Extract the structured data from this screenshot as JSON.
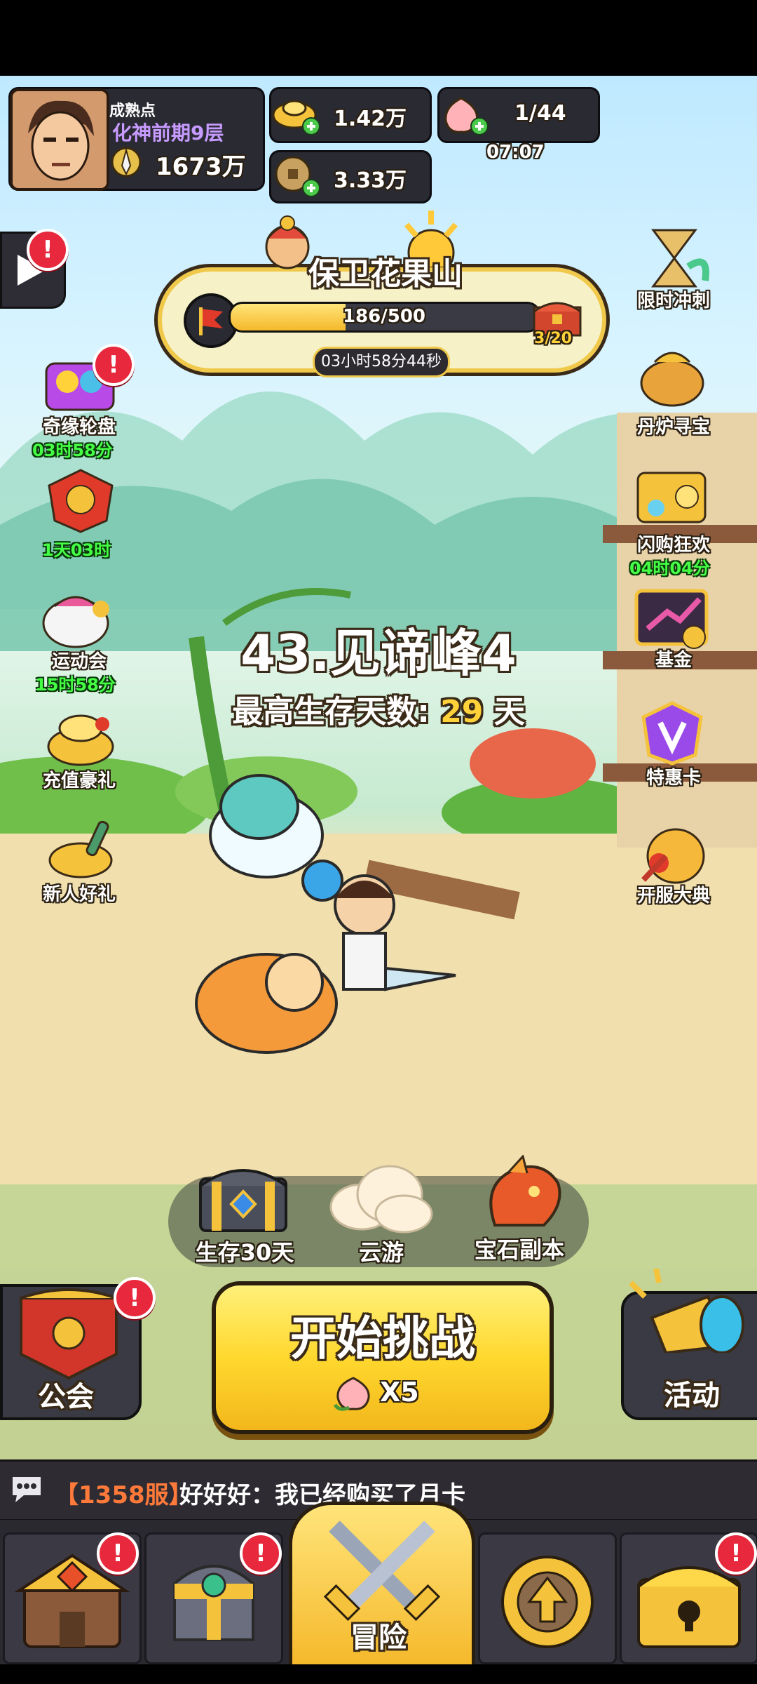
{
  "player": {
    "maturity_label": "成熟点",
    "realm": "化神前期9层",
    "power": "1673万"
  },
  "resources": {
    "gold": "1.42万",
    "coins": "3.33万",
    "peach": "1/44",
    "peach_timer": "07:07"
  },
  "event_banner": {
    "title": "保卫花果山",
    "progress_text": "186/500",
    "progress_fraction": 0.372,
    "chest_count": "3/20",
    "countdown": "03小时58分44秒"
  },
  "left_menu": [
    {
      "label": "奇缘轮盘",
      "timer": "03时58分",
      "badge": "!"
    },
    {
      "label": "",
      "timer": "1天03时"
    },
    {
      "label": "运动会",
      "timer": "15时58分"
    },
    {
      "label": "充值豪礼",
      "timer": ""
    },
    {
      "label": "新人好礼",
      "timer": ""
    }
  ],
  "right_menu": [
    {
      "label": "限时冲刺",
      "timer": ""
    },
    {
      "label": "丹炉寻宝",
      "timer": ""
    },
    {
      "label": "闪购狂欢",
      "timer": "04时04分"
    },
    {
      "label": "基金",
      "timer": ""
    },
    {
      "label": "特惠卡",
      "timer": ""
    },
    {
      "label": "开服大典",
      "timer": ""
    }
  ],
  "stage": {
    "name": "43.见谛峰4",
    "survival_label": "最高生存天数:",
    "survival_days": "29",
    "survival_unit": "天"
  },
  "modes": [
    "生存30天",
    "云游",
    "宝石副本"
  ],
  "actions": {
    "guild": "公会",
    "start": "开始挑战",
    "cost": "X5",
    "activity": "活动"
  },
  "chat": {
    "server": "【1358服】",
    "message": "好好好：我已经购买了月卡"
  },
  "bottom_nav": {
    "center_label": "冒险"
  },
  "badge_mark": "!",
  "colors": {
    "accent_yellow": "#ffd23a",
    "badge_red": "#e8283c",
    "timer_green": "#45ff45",
    "realm_purple": "#c79bff"
  }
}
